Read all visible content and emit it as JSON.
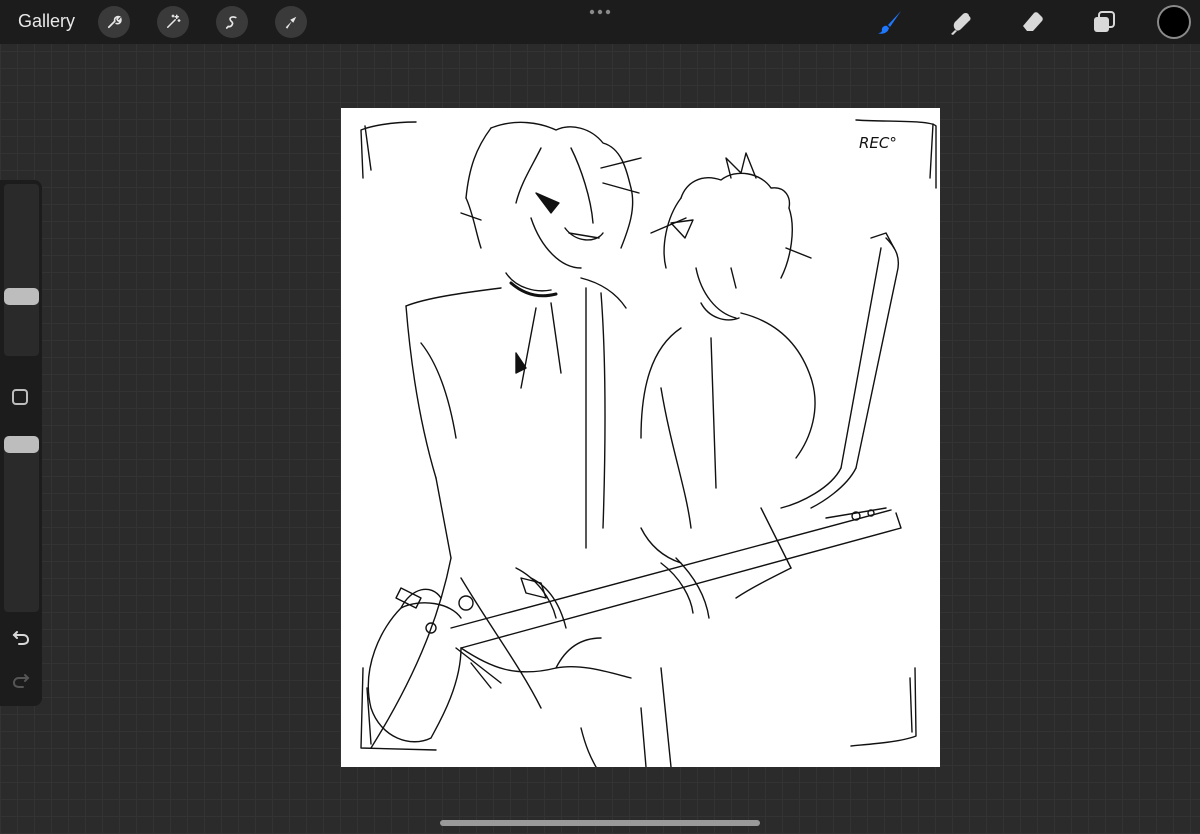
{
  "topbar": {
    "gallery_label": "Gallery",
    "left_tools": [
      "wrench-icon",
      "magic-wand-icon",
      "selection-icon",
      "transform-arrow-icon"
    ],
    "right_tools": [
      "brush-icon",
      "smudge-icon",
      "eraser-icon",
      "layers-icon"
    ],
    "active_tool": "brush",
    "active_color": "#1e78ff",
    "current_color": "#000000"
  },
  "sidebar": {
    "brush_size_level": 0.33,
    "opacity_level": 1.0
  },
  "canvas": {
    "rec_label": "REC°"
  }
}
